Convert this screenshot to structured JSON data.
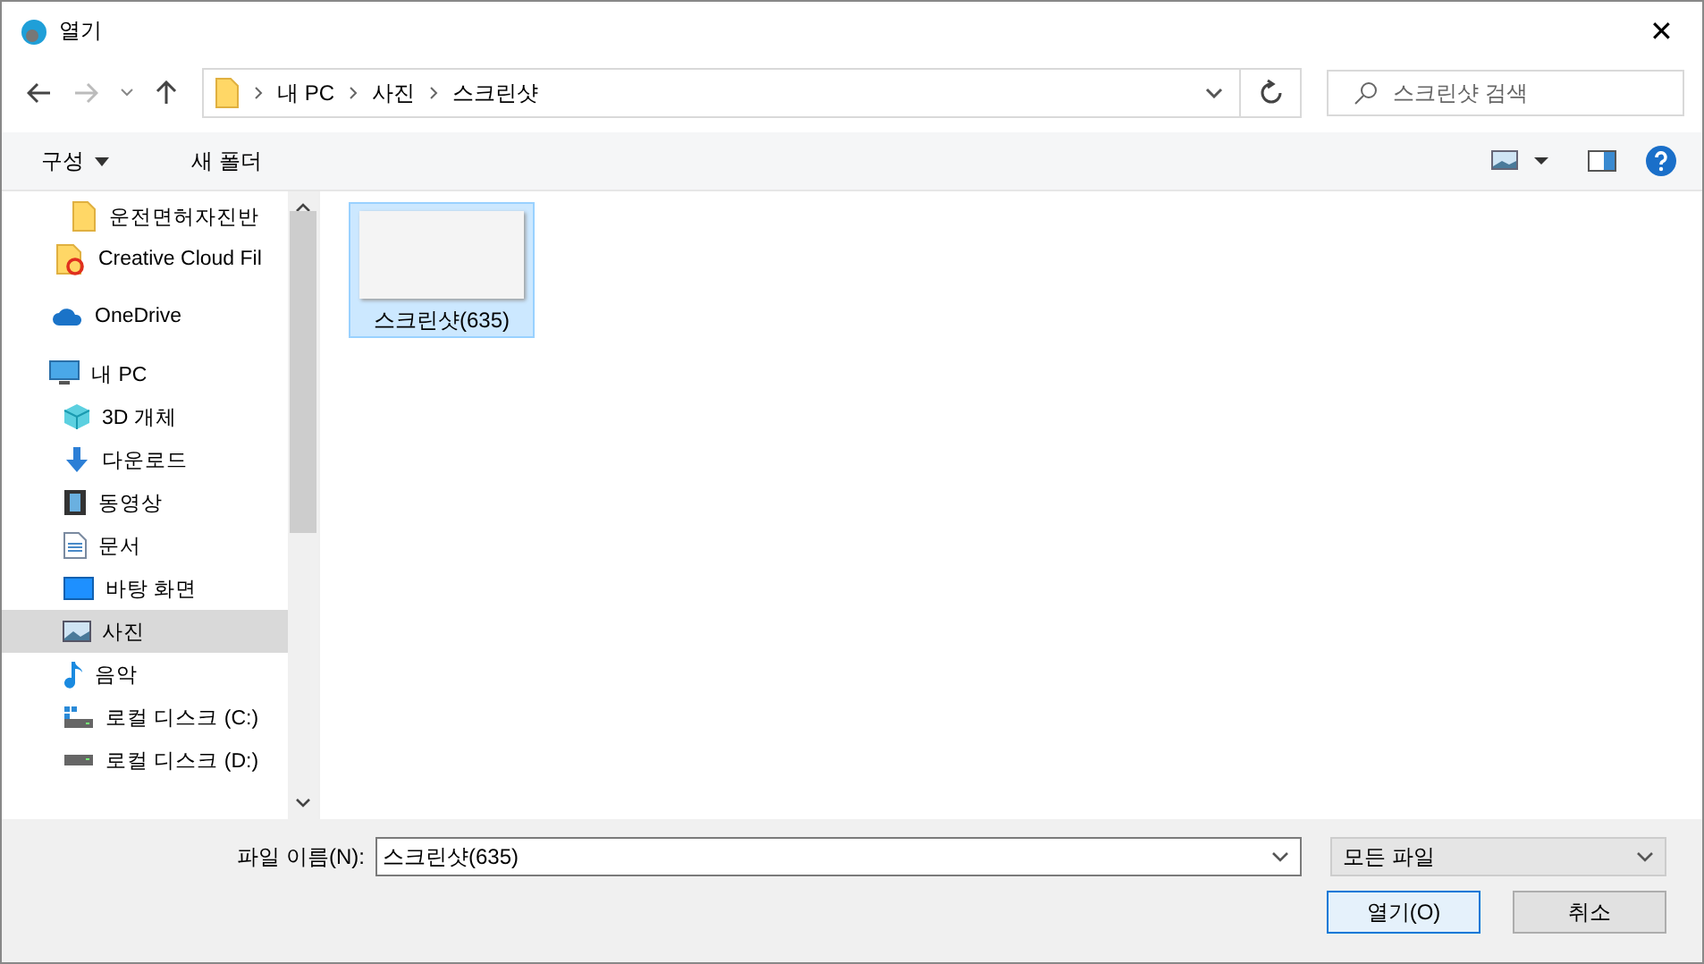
{
  "window": {
    "title": "열기",
    "close": "✕"
  },
  "nav": {
    "breadcrumb": [
      "내 PC",
      "사진",
      "스크린샷"
    ],
    "search": {
      "placeholder": "스크린샷 검색"
    }
  },
  "toolbar": {
    "organize": "구성",
    "new_folder": "새 폴더"
  },
  "sidebar": {
    "items": [
      {
        "kind": "folder",
        "label": "운전면허자진반",
        "selected": false
      },
      {
        "kind": "cc-folder",
        "label": "Creative Cloud Fil",
        "selected": false
      },
      {
        "kind": "onedrive",
        "label": "OneDrive",
        "selected": false
      },
      {
        "kind": "pc",
        "label": "내 PC",
        "selected": false,
        "children": [
          {
            "kind": "cube",
            "label": "3D 개체",
            "selected": false
          },
          {
            "kind": "download",
            "label": "다운로드",
            "selected": false
          },
          {
            "kind": "video",
            "label": "동영상",
            "selected": false
          },
          {
            "kind": "doc",
            "label": "문서",
            "selected": false
          },
          {
            "kind": "desktop",
            "label": "바탕 화면",
            "selected": false
          },
          {
            "kind": "pictures",
            "label": "사진",
            "selected": true
          },
          {
            "kind": "music",
            "label": "음악",
            "selected": false
          },
          {
            "kind": "drive-win",
            "label": "로컬 디스크 (C:)",
            "selected": false
          },
          {
            "kind": "drive",
            "label": "로컬 디스크 (D:)",
            "selected": false
          }
        ]
      }
    ]
  },
  "files": [
    {
      "name": "스크린샷(635)",
      "selected": true
    }
  ],
  "bottom": {
    "filename_label": "파일 이름(N):",
    "filename": "스크린샷(635)",
    "filter": "모든 파일",
    "open": "열기(O)",
    "cancel": "취소"
  }
}
